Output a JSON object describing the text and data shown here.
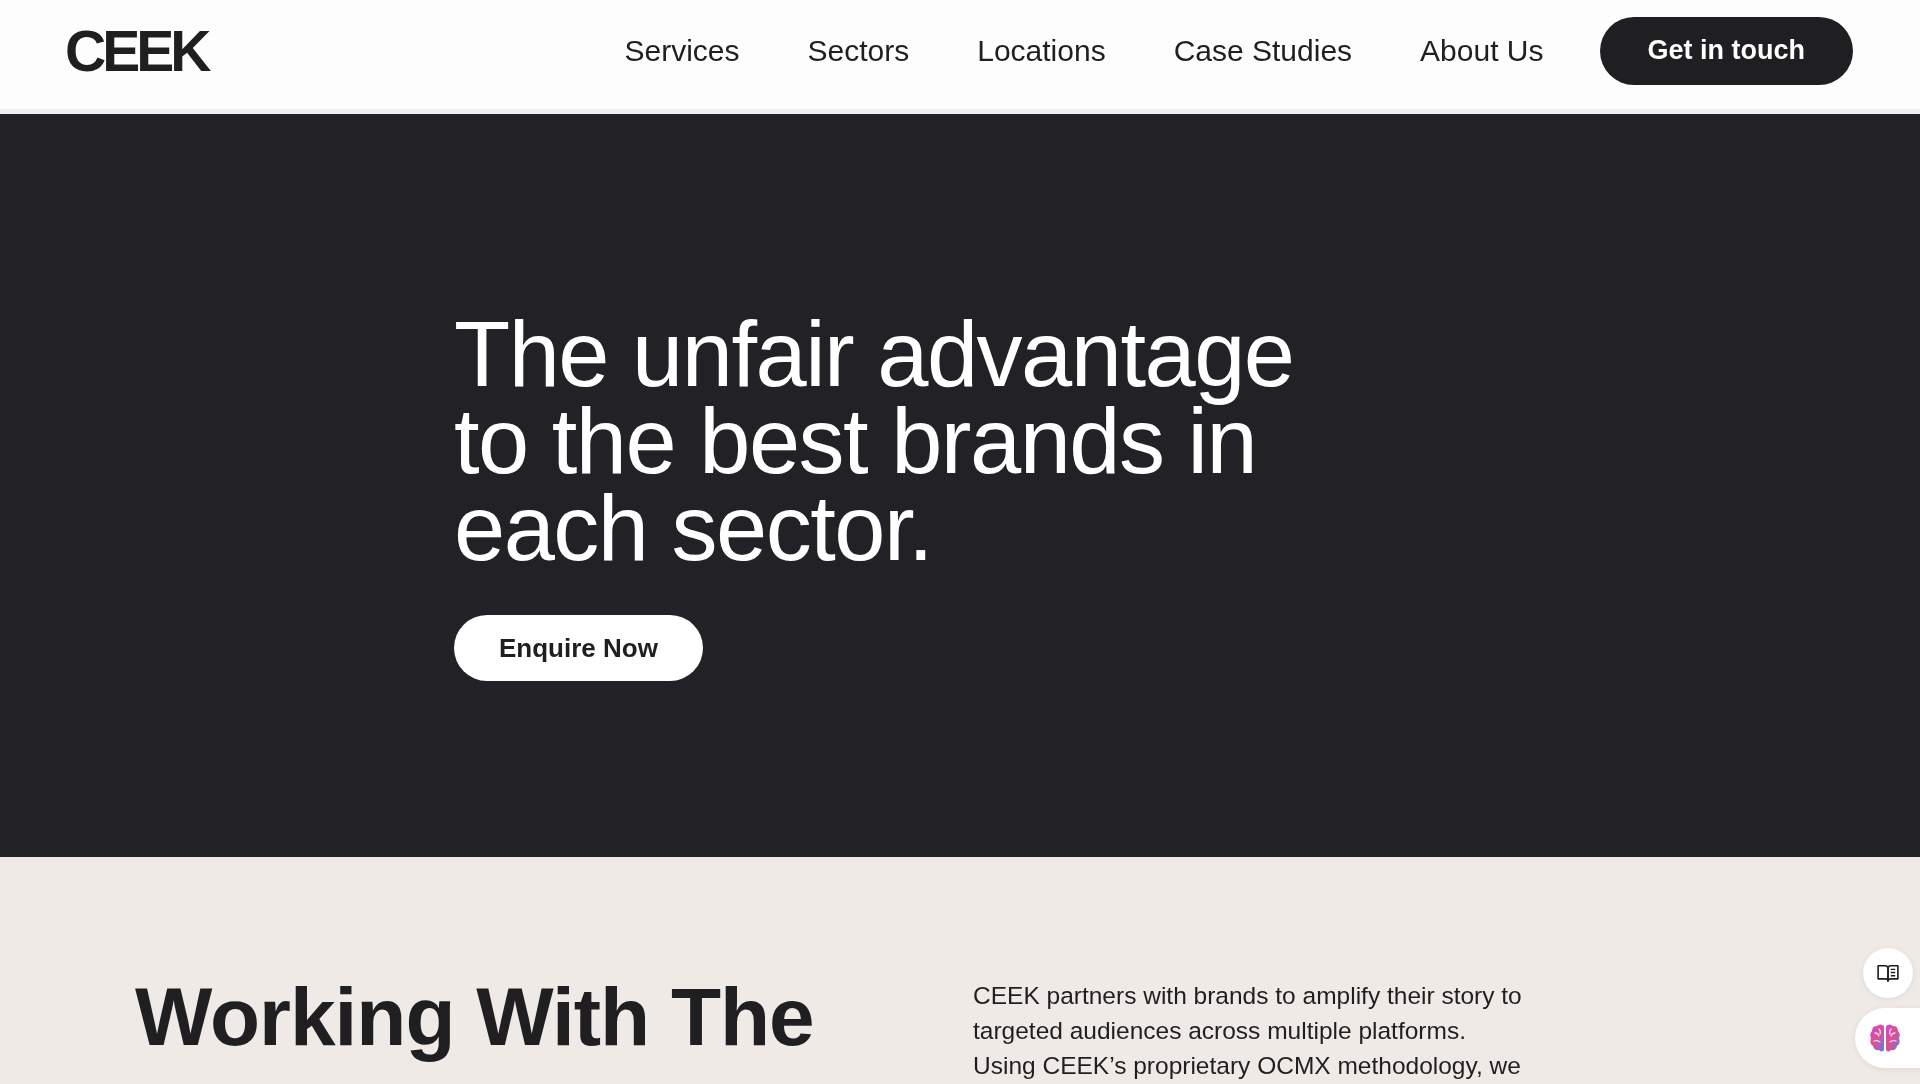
{
  "header": {
    "logo": "CEEK",
    "nav": [
      {
        "label": "Services"
      },
      {
        "label": "Sectors"
      },
      {
        "label": "Locations"
      },
      {
        "label": "Case Studies"
      },
      {
        "label": "About Us"
      }
    ],
    "cta": "Get in touch"
  },
  "hero": {
    "heading": "The unfair advantage to the best brands in each sector.",
    "button": "Enquire Now"
  },
  "intro": {
    "heading": "Working With The",
    "paragraph": "CEEK partners with brands to amplify their story to targeted audiences across multiple platforms. Using CEEK’s proprietary OCMX methodology, we"
  }
}
